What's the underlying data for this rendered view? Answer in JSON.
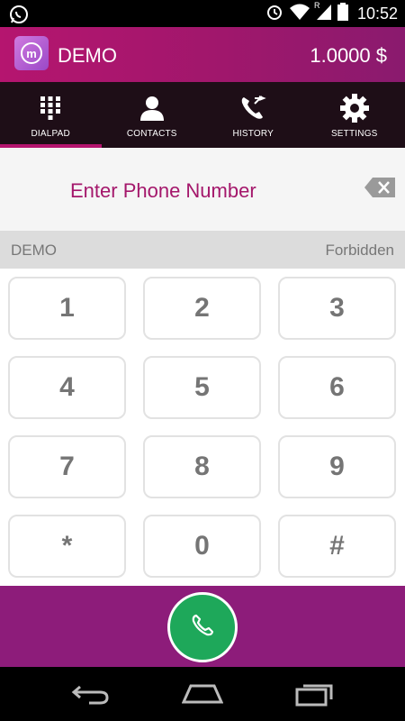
{
  "status_bar": {
    "time": "10:52",
    "icons": [
      "whatsapp-icon",
      "alarm-icon",
      "wifi-icon",
      "signal-icon",
      "battery-icon"
    ],
    "roaming_indicator": "R"
  },
  "header": {
    "title": "DEMO",
    "balance": "1.0000 $",
    "logo_letter": "m"
  },
  "tabs": [
    {
      "label": "DIALPAD",
      "icon": "dialpad-icon",
      "active": true
    },
    {
      "label": "CONTACTS",
      "icon": "contacts-icon",
      "active": false
    },
    {
      "label": "HISTORY",
      "icon": "history-icon",
      "active": false
    },
    {
      "label": "SETTINGS",
      "icon": "settings-icon",
      "active": false
    }
  ],
  "phone_input": {
    "placeholder": "Enter Phone Number",
    "value": ""
  },
  "info_row": {
    "account": "DEMO",
    "status": "Forbidden"
  },
  "keypad": {
    "keys": [
      "1",
      "2",
      "3",
      "4",
      "5",
      "6",
      "7",
      "8",
      "9",
      "*",
      "0",
      "#"
    ]
  },
  "colors": {
    "brand": "#b5156f",
    "tabbar": "#1e0e17",
    "callbar": "#8d1c7a",
    "call_button": "#1ea85a"
  }
}
